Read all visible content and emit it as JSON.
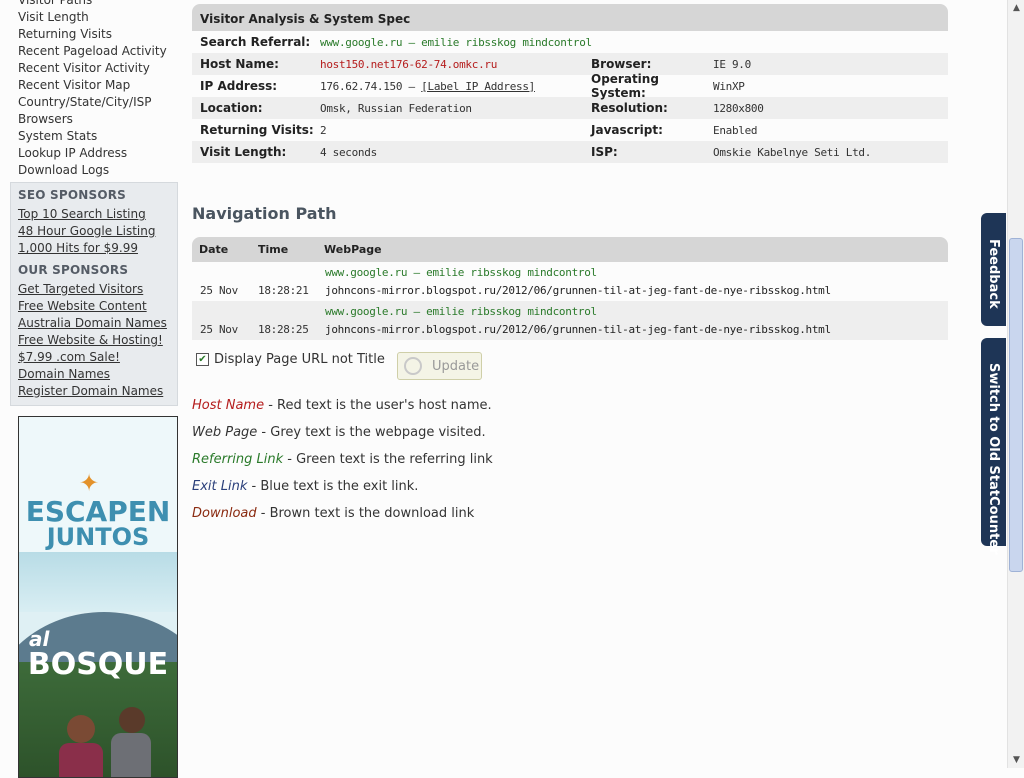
{
  "sidebar": {
    "links": [
      "Visitor Paths",
      "Visit Length",
      "Returning Visits",
      "Recent Pageload Activity",
      "Recent Visitor Activity",
      "Recent Visitor Map",
      "Country/State/City/ISP",
      "Browsers",
      "System Stats",
      "Lookup IP Address",
      "Download Logs"
    ],
    "seo_heading": "SEO SPONSORS",
    "seo_links": [
      "Top 10 Search Listing",
      "48 Hour Google Listing",
      "1,000 Hits for $9.99"
    ],
    "our_heading": "OUR SPONSORS",
    "our_links": [
      "Get Targeted Visitors",
      "Free Website Content",
      "Australia Domain Names",
      "Free Website & Hosting!",
      "$7.99 .com Sale!",
      "Domain Names",
      "Register Domain Names"
    ],
    "ad": {
      "line1": "ESCAPEN",
      "line2": "JUNTOS",
      "line3": "al",
      "line4": "BOSQUE"
    }
  },
  "spec": {
    "title": "Visitor Analysis & System Spec",
    "search_referral_label": "Search Referral:",
    "search_referral_value": "www.google.ru — emilie ribsskog mindcontrol",
    "rows": [
      {
        "l1": "Host Name:",
        "v1": "host150.net176-62-74.omkc.ru",
        "l2": "Browser:",
        "v2": "IE 9.0"
      },
      {
        "l1": "IP Address:",
        "v1": "176.62.74.150 — ",
        "link": "[Label IP Address]",
        "l2": "Operating System:",
        "v2": "WinXP"
      },
      {
        "l1": "Location:",
        "v1": "Omsk, Russian Federation",
        "l2": "Resolution:",
        "v2": "1280x800"
      },
      {
        "l1": "Returning Visits:",
        "v1": "2",
        "l2": "Javascript:",
        "v2": "Enabled"
      },
      {
        "l1": "Visit Length:",
        "v1": "4 seconds",
        "l2": "ISP:",
        "v2": "Omskie Kabelnye Seti Ltd."
      }
    ]
  },
  "nav": {
    "title": "Navigation Path",
    "headers": [
      "Date",
      "Time",
      "WebPage"
    ],
    "rows": [
      {
        "date": "25 Nov",
        "time": "18:28:21",
        "ref": "www.google.ru — emilie ribsskog mindcontrol",
        "url": "johncons-mirror.blogspot.ru/2012/06/grunnen-til-at-jeg-fant-de-nye-ribsskog.html"
      },
      {
        "date": "25 Nov",
        "time": "18:28:25",
        "ref": "www.google.ru — emilie ribsskog mindcontrol",
        "url": "johncons-mirror.blogspot.ru/2012/06/grunnen-til-at-jeg-fant-de-nye-ribsskog.html"
      }
    ]
  },
  "options": {
    "checkbox_label": "Display Page URL not Title",
    "update_label": "Update"
  },
  "legend": [
    {
      "key": "Host Name",
      "text": " - Red text is the user's host name."
    },
    {
      "key": "Web Page",
      "text": " - Grey text is the webpage visited."
    },
    {
      "key": "Referring Link",
      "text": " - Green text is the referring link"
    },
    {
      "key": "Exit Link",
      "text": " - Blue text is the exit link."
    },
    {
      "key": "Download",
      "text": " - Brown text is the download link"
    }
  ],
  "tabs": {
    "feedback": "Feedback",
    "switch": "Switch to Old StatCounter"
  },
  "colors": {
    "red": "#b51d1d",
    "green": "#2a7a2a",
    "blue": "#2a3f7a",
    "brown": "#8a2a10",
    "tab": "#1e3556"
  }
}
